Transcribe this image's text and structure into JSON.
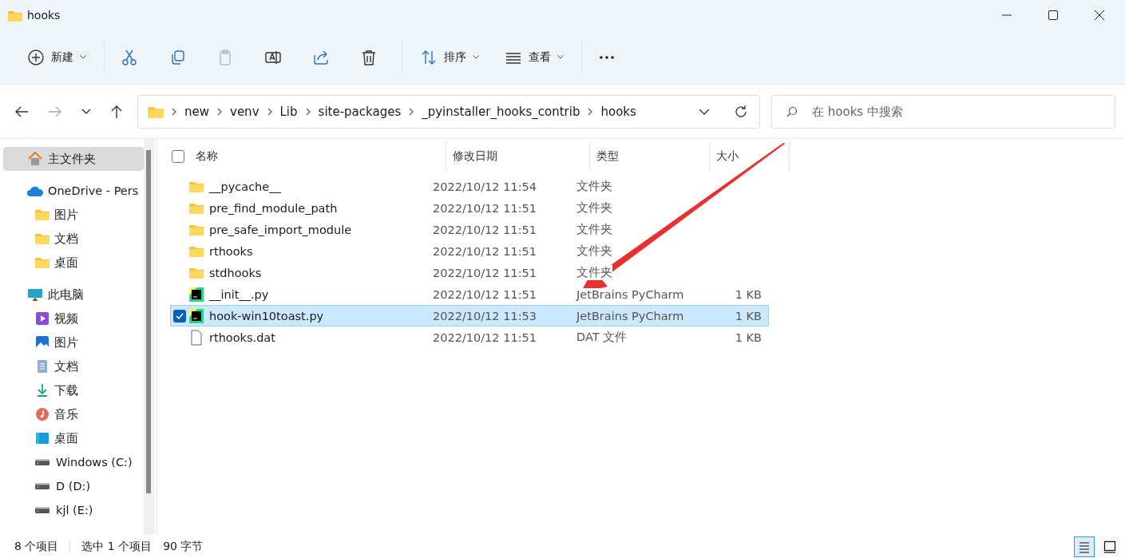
{
  "window": {
    "title": "hooks"
  },
  "toolbar": [
    {
      "kind": "new",
      "label": "新建",
      "disabled": false
    },
    {
      "kind": "cut",
      "disabled": false
    },
    {
      "kind": "copy",
      "disabled": false
    },
    {
      "kind": "paste",
      "disabled": true
    },
    {
      "kind": "rename",
      "disabled": false
    },
    {
      "kind": "share",
      "disabled": false
    },
    {
      "kind": "delete",
      "disabled": false
    },
    {
      "kind": "sort",
      "label": "排序",
      "disabled": false
    },
    {
      "kind": "view",
      "label": "查看",
      "disabled": false
    },
    {
      "kind": "more",
      "disabled": false
    }
  ],
  "address": {
    "segments": [
      "new",
      "venv",
      "Lib",
      "site-packages",
      "_pyinstaller_hooks_contrib",
      "hooks"
    ]
  },
  "search": {
    "placeholder": "在 hooks 中搜索"
  },
  "sidebar": {
    "items": [
      {
        "kind": "home",
        "label": "主文件夹",
        "selected": true
      },
      {
        "kind": "cloud",
        "label": "OneDrive - Pers",
        "selected": false,
        "children": [
          {
            "kind": "folder",
            "label": "图片",
            "selected": false
          },
          {
            "kind": "folder",
            "label": "文档",
            "selected": false
          },
          {
            "kind": "folder",
            "label": "桌面",
            "selected": false
          }
        ]
      },
      {
        "kind": "pc",
        "label": "此电脑",
        "selected": false,
        "children": [
          {
            "kind": "video",
            "label": "视频",
            "selected": false
          },
          {
            "kind": "pictures",
            "label": "图片",
            "selected": false
          },
          {
            "kind": "document",
            "label": "文档",
            "selected": false
          },
          {
            "kind": "download",
            "label": "下载",
            "selected": false
          },
          {
            "kind": "music",
            "label": "音乐",
            "selected": false
          },
          {
            "kind": "desktop",
            "label": "桌面",
            "selected": false
          },
          {
            "kind": "drive",
            "label": "Windows (C:)",
            "selected": false
          },
          {
            "kind": "drive",
            "label": "D (D:)",
            "selected": false
          },
          {
            "kind": "drive",
            "label": "kjl (E:)",
            "selected": false
          }
        ]
      }
    ]
  },
  "table": {
    "all_checked": false,
    "columns": [
      "名称",
      "修改日期",
      "类型",
      "大小"
    ],
    "rows": [
      {
        "kind": "folder",
        "name": "__pycache__",
        "date": "2022/10/12 11:54",
        "type": "文件夹",
        "selected": false
      },
      {
        "kind": "folder",
        "name": "pre_find_module_path",
        "date": "2022/10/12 11:51",
        "type": "文件夹",
        "selected": false
      },
      {
        "kind": "folder",
        "name": "pre_safe_import_module",
        "date": "2022/10/12 11:51",
        "type": "文件夹",
        "selected": false
      },
      {
        "kind": "folder",
        "name": "rthooks",
        "date": "2022/10/12 11:51",
        "type": "文件夹",
        "selected": false
      },
      {
        "kind": "folder",
        "name": "stdhooks",
        "date": "2022/10/12 11:51",
        "type": "文件夹",
        "selected": false
      },
      {
        "kind": "pycharm",
        "name": "__init__.py",
        "date": "2022/10/12 11:51",
        "type": "JetBrains PyCharm",
        "size": "1 KB",
        "selected": false
      },
      {
        "kind": "pycharm",
        "name": "hook-win10toast.py",
        "date": "2022/10/12 11:53",
        "type": "JetBrains PyCharm",
        "size": "1 KB",
        "selected": true
      },
      {
        "kind": "file",
        "name": "rthooks.dat",
        "date": "2022/10/12 11:51",
        "type": "DAT 文件",
        "size": "1 KB",
        "selected": false
      }
    ]
  },
  "status_bar": {
    "count": "8 个项目",
    "selection": "选中 1 个项目",
    "bytes": "90 字节",
    "views": [
      {
        "kind": "details",
        "selected": true
      },
      {
        "kind": "tiles",
        "selected": false
      }
    ]
  }
}
